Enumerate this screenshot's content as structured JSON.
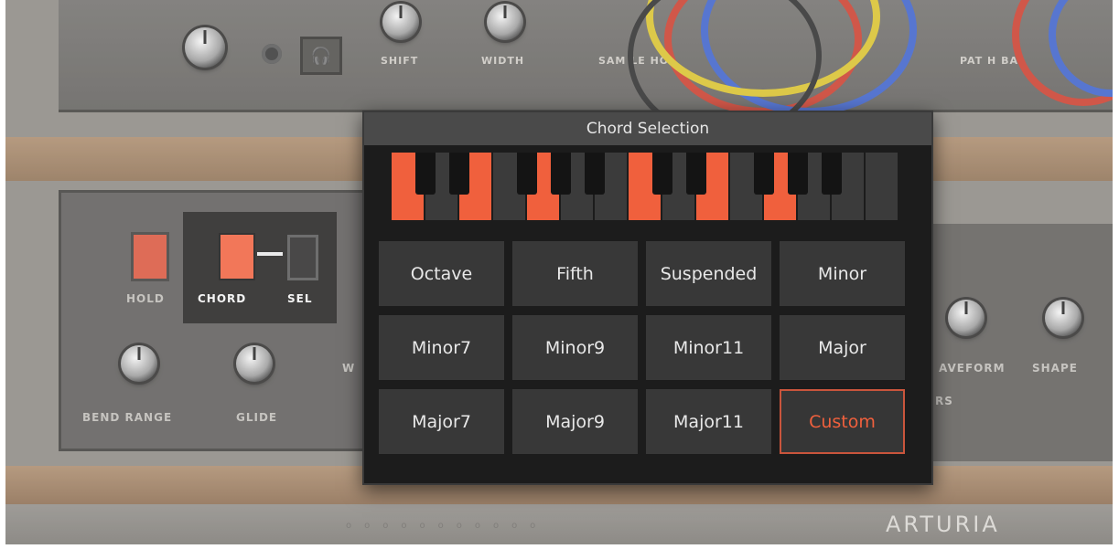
{
  "background": {
    "top_labels": [
      "SHIFT",
      "WIDTH",
      "SAM   LE   HOL",
      "PAT  H BA"
    ],
    "hold_label": "HOLD",
    "chord_label": "CHORD",
    "sel_label": "SEL",
    "bend_label": "BEND RANGE",
    "glide_label": "GLIDE",
    "waveform_label": "AVEFORM",
    "shape_label": "SHAPE",
    "rs_label": "RS",
    "wa_label": "W",
    "brand": "ARTURIA",
    "colors": {
      "accent": "#f0603d",
      "cable_red": "#c83a2a",
      "cable_blue": "#3a5ec8",
      "cable_yellow": "#d8c02a"
    }
  },
  "dialog": {
    "title": "Chord Selection",
    "active_white_keys": [
      0,
      2,
      4,
      7,
      9,
      11
    ],
    "active_black_keys": [],
    "chords": [
      {
        "label": "Octave"
      },
      {
        "label": "Fifth"
      },
      {
        "label": "Suspended"
      },
      {
        "label": "Minor"
      },
      {
        "label": "Minor7"
      },
      {
        "label": "Minor9"
      },
      {
        "label": "Minor11"
      },
      {
        "label": "Major"
      },
      {
        "label": "Major7"
      },
      {
        "label": "Major9"
      },
      {
        "label": "Major11"
      },
      {
        "label": "Custom",
        "selected": true
      }
    ]
  }
}
